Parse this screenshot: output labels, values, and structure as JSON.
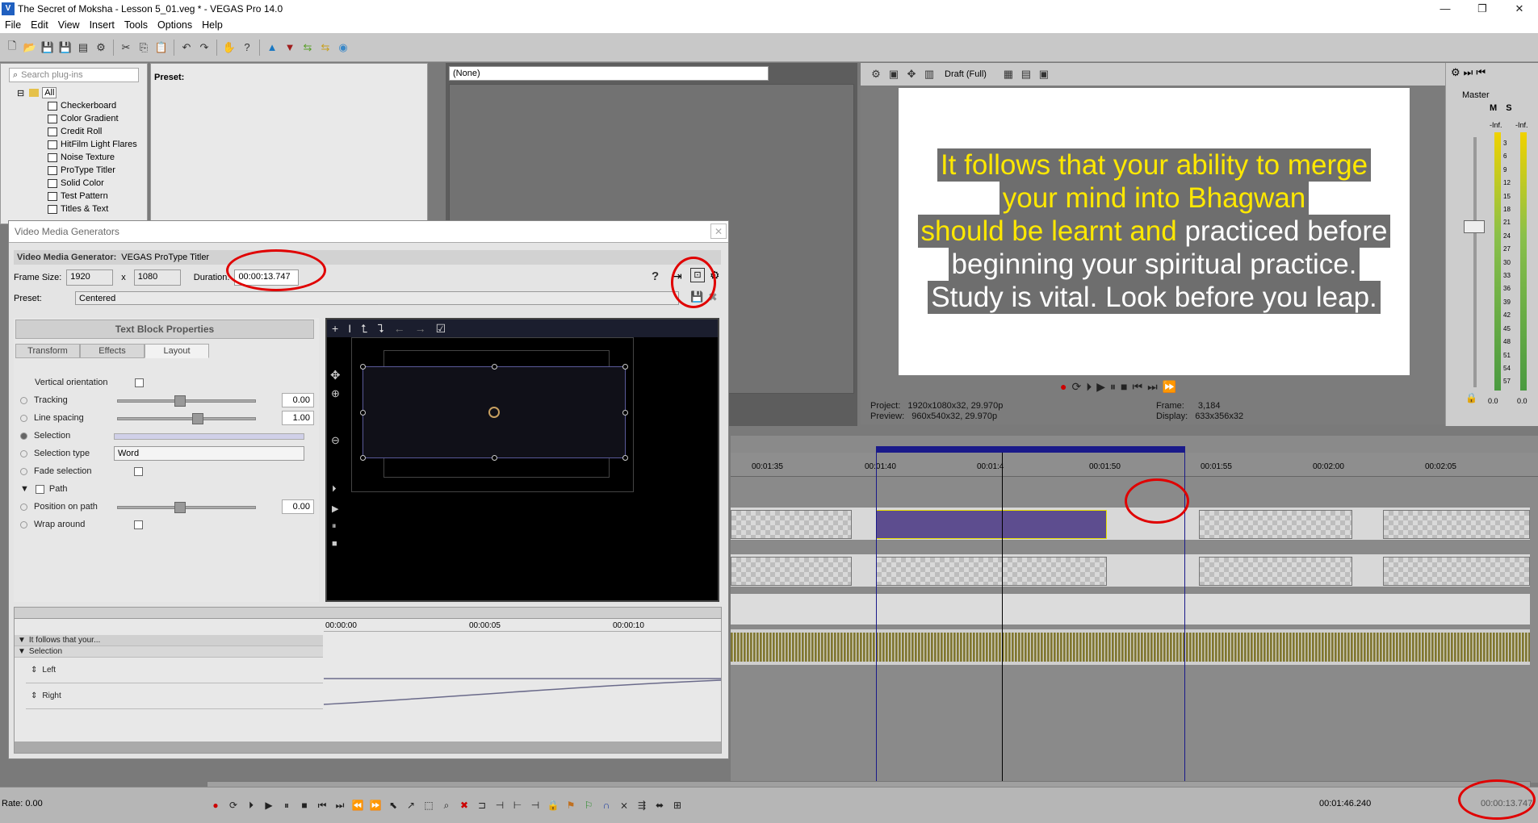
{
  "window": {
    "title": "The Secret of Moksha - Lesson 5_01.veg * - VEGAS Pro 14.0",
    "app_icon": "V"
  },
  "menu": [
    "File",
    "Edit",
    "View",
    "Insert",
    "Tools",
    "Options",
    "Help"
  ],
  "plugins": {
    "search_placeholder": "Search plug-ins",
    "root": "All",
    "items": [
      "Checkerboard",
      "Color Gradient",
      "Credit Roll",
      "HitFilm Light Flares",
      "Noise Texture",
      "ProType Titler",
      "Solid Color",
      "Test Pattern",
      "Titles & Text"
    ]
  },
  "preset_panel": {
    "label": "Preset:"
  },
  "mid_panel": {
    "select_value": "(None)"
  },
  "preview": {
    "quality": "Draft (Full)",
    "caption_lines": [
      {
        "yellow": "It follows that your ability to merge",
        "white": ""
      },
      {
        "yellow": "your mind into Bhagwan",
        "white": ""
      },
      {
        "yellow": "should be learnt and ",
        "white": "practiced before"
      },
      {
        "yellow": "",
        "white": "beginning your spiritual practice."
      },
      {
        "yellow": "",
        "white": " Study is vital. Look before you leap."
      }
    ],
    "project_label": "Project:",
    "project_value": "1920x1080x32, 29.970p",
    "preview_label": "Preview:",
    "preview_value": "960x540x32, 29.970p",
    "frame_label": "Frame:",
    "frame_value": "3,184",
    "display_label": "Display:",
    "display_value": "633x356x32"
  },
  "master": {
    "label": "Master",
    "m": "M",
    "s": "S",
    "inf_left": "-Inf.",
    "inf_right": "-Inf.",
    "db": [
      "3",
      "6",
      "9",
      "12",
      "15",
      "18",
      "21",
      "24",
      "27",
      "30",
      "33",
      "36",
      "39",
      "42",
      "45",
      "48",
      "51",
      "54",
      "57"
    ],
    "bottom_left": "0.0",
    "bottom_right": "0.0"
  },
  "timeline": {
    "ticks": [
      "00:01:35",
      "00:01:40",
      "00:01:4",
      "00:01:50",
      "00:01:55",
      "00:02:00",
      "00:02:05"
    ]
  },
  "vmg": {
    "window_title": "Video Media Generators",
    "generator_label": "Video Media Generator:",
    "generator_value": "VEGAS ProType Titler",
    "frame_size_label": "Frame Size:",
    "frame_w": "1920",
    "x_label": "x",
    "frame_h": "1080",
    "duration_label": "Duration:",
    "duration_value": "00:00:13.747",
    "preset_label": "Preset:",
    "preset_value": "Centered",
    "tbp_title": "Text Block Properties",
    "tabs": [
      "Transform",
      "Effects",
      "Layout"
    ],
    "props": {
      "vertical": "Vertical orientation",
      "tracking": "Tracking",
      "tracking_val": "0.00",
      "line_spacing": "Line spacing",
      "line_spacing_val": "1.00",
      "selection": "Selection",
      "selection_type": "Selection type",
      "selection_type_val": "Word",
      "fade": "Fade selection",
      "path": "Path",
      "position": "Position on path",
      "position_val": "0.00",
      "wrap": "Wrap around"
    },
    "kf": {
      "ticks": [
        "00:00:00",
        "00:00:05",
        "00:00:10"
      ],
      "rows": [
        "It follows that your...",
        "Selection",
        "Left",
        "Right"
      ]
    }
  },
  "status": {
    "rate": "Rate: 0.00",
    "time": "00:01:46.240",
    "time2": "00:00:13.747"
  }
}
